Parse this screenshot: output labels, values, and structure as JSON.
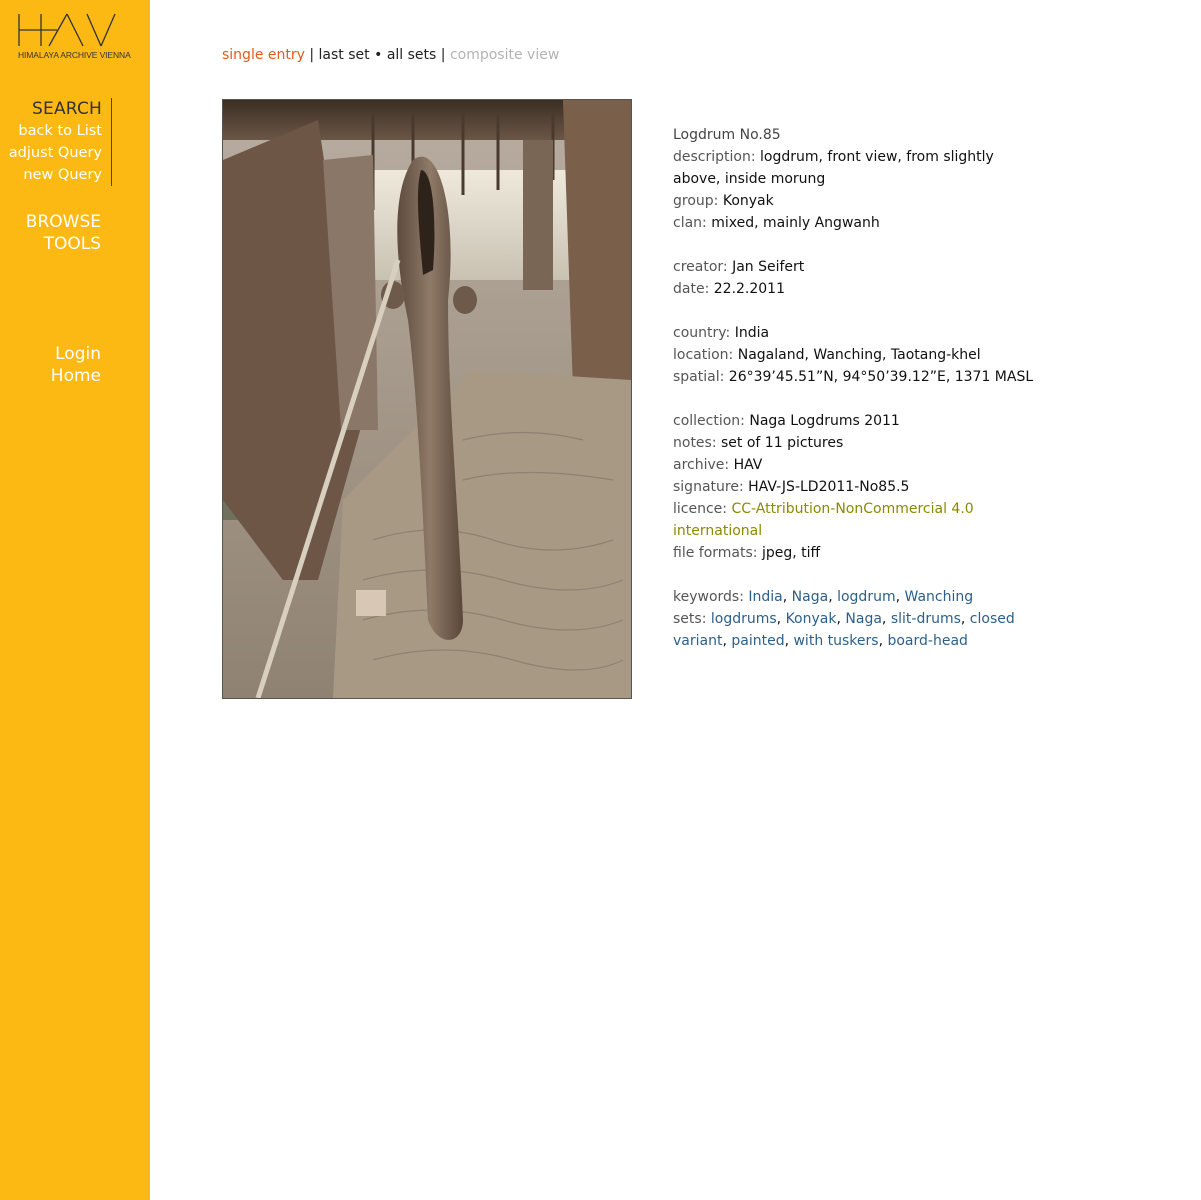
{
  "logo": {
    "text": "HAV",
    "subtitle": "HIMALAYA ARCHIVE VIENNA"
  },
  "sidebar": {
    "search_title": "SEARCH",
    "search_links": [
      "back to List",
      "adjust Query",
      "new Query"
    ],
    "browse": "BROWSE",
    "tools": "TOOLS",
    "login": "Login",
    "home": "Home"
  },
  "viewbar": {
    "single_entry": "single entry",
    "sep1": "|",
    "last_set": "last set",
    "bullet": "•",
    "all_sets": "all sets",
    "sep2": "|",
    "composite_view": "composite view"
  },
  "photo": {
    "subject": "logdrum, front view, from slightly above, inside morung"
  },
  "entry": {
    "title": "Logdrum No.85",
    "description": {
      "label": "description:",
      "value": "logdrum, front view, from slightly above, inside morung"
    },
    "group": {
      "label": "group:",
      "value": "Konyak"
    },
    "clan": {
      "label": "clan:",
      "value": "mixed, mainly Angwanh"
    },
    "creator": {
      "label": "creator:",
      "value": "Jan Seifert"
    },
    "date": {
      "label": "date:",
      "value": "22.2.2011"
    },
    "country": {
      "label": "country:",
      "value": "India"
    },
    "location": {
      "label": "location:",
      "value": "Nagaland, Wanching, Taotang-khel"
    },
    "spatial": {
      "label": "spatial:",
      "value": "26°39’45.51”N, 94°50’39.12”E, 1371 MASL"
    },
    "collection": {
      "label": "collection:",
      "value": "Naga Logdrums 2011"
    },
    "notes": {
      "label": "notes:",
      "value": "set of 11 pictures"
    },
    "archive": {
      "label": "archive:",
      "value": "HAV"
    },
    "signature": {
      "label": "signature:",
      "value": "HAV-JS-LD2011-No85.5"
    },
    "licence": {
      "label": "licence:",
      "value": "CC-Attribution-NonCommercial 4.0 international"
    },
    "file_formats": {
      "label": "file formats:",
      "value": "jpeg, tiff"
    },
    "keywords": {
      "label": "keywords:",
      "items": [
        "India",
        "Naga",
        "logdrum",
        "Wanching"
      ]
    },
    "sets": {
      "label": "sets:",
      "items": [
        "logdrums",
        "Konyak",
        "Naga",
        "slit-drums",
        "closed variant",
        "painted",
        "with tuskers",
        "board-head"
      ]
    },
    "comma": ","
  },
  "colors": {
    "sidebar": "#fdb913",
    "active_view": "#e05a1c",
    "licence": "#8a8a00",
    "keyword_link": "#2c5f8a",
    "disabled": "#b3b3b3"
  }
}
